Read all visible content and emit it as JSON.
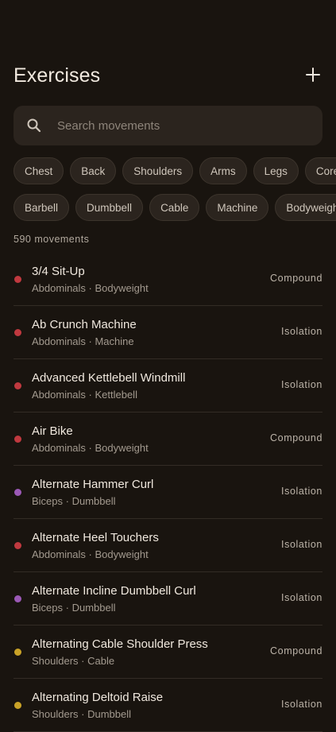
{
  "header": {
    "title": "Exercises",
    "add_icon": "plus-icon"
  },
  "search": {
    "placeholder": "Search movements",
    "icon": "search-icon",
    "value": ""
  },
  "filters": {
    "muscles": [
      "Chest",
      "Back",
      "Shoulders",
      "Arms",
      "Legs",
      "Core"
    ],
    "equipment": [
      "Barbell",
      "Dumbbell",
      "Cable",
      "Machine",
      "Bodyweight"
    ]
  },
  "count_label": "590 movements",
  "colors": {
    "background": "#19140f",
    "surface": "#2b241e",
    "abdominals": "#c0393f",
    "biceps": "#9b59b6",
    "shoulders": "#c9a227"
  },
  "exercises": [
    {
      "name": "3/4 Sit-Up",
      "meta": "Abdominals · Bodyweight",
      "type": "Compound",
      "color": "#c0393f"
    },
    {
      "name": "Ab Crunch Machine",
      "meta": "Abdominals · Machine",
      "type": "Isolation",
      "color": "#c0393f"
    },
    {
      "name": "Advanced Kettlebell Windmill",
      "meta": "Abdominals · Kettlebell",
      "type": "Isolation",
      "color": "#c0393f"
    },
    {
      "name": "Air Bike",
      "meta": "Abdominals · Bodyweight",
      "type": "Compound",
      "color": "#c0393f"
    },
    {
      "name": "Alternate Hammer Curl",
      "meta": "Biceps · Dumbbell",
      "type": "Isolation",
      "color": "#9b59b6"
    },
    {
      "name": "Alternate Heel Touchers",
      "meta": "Abdominals · Bodyweight",
      "type": "Isolation",
      "color": "#c0393f"
    },
    {
      "name": "Alternate Incline Dumbbell Curl",
      "meta": "Biceps · Dumbbell",
      "type": "Isolation",
      "color": "#9b59b6"
    },
    {
      "name": "Alternating Cable Shoulder Press",
      "meta": "Shoulders · Cable",
      "type": "Compound",
      "color": "#c9a227"
    },
    {
      "name": "Alternating Deltoid Raise",
      "meta": "Shoulders · Dumbbell",
      "type": "Isolation",
      "color": "#c9a227"
    }
  ]
}
